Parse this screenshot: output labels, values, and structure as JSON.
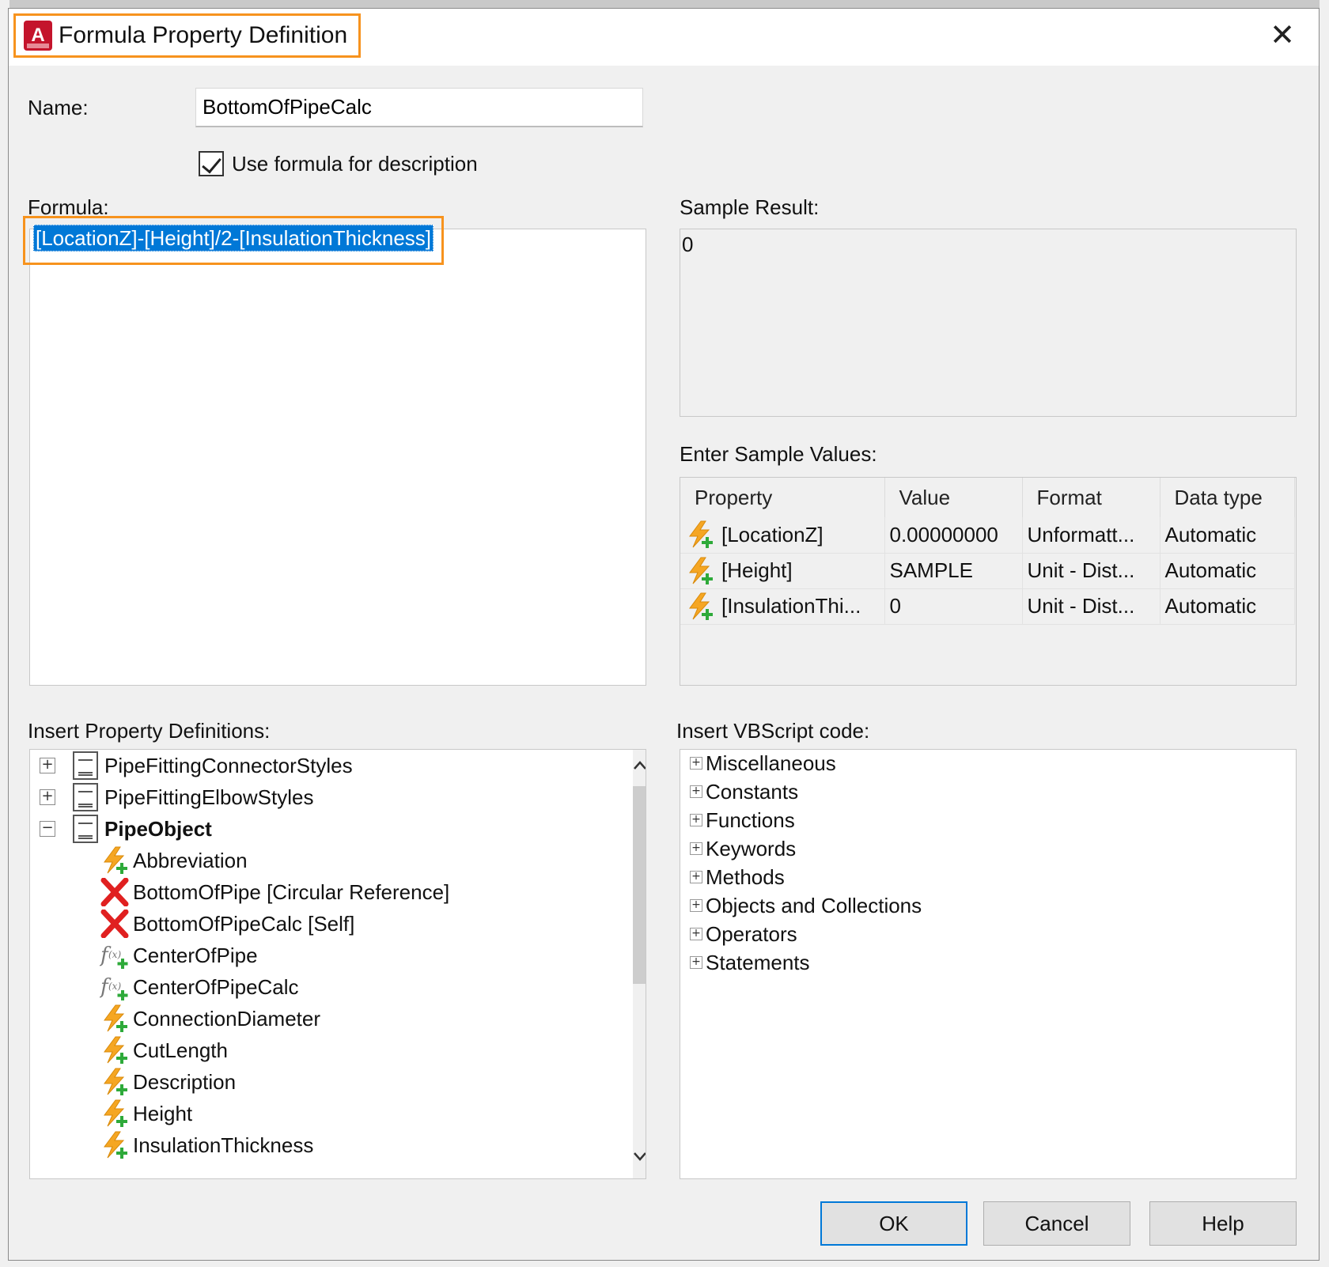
{
  "dialog": {
    "title": "Formula Property Definition",
    "app_icon_letter": "A",
    "close_glyph": "✕"
  },
  "name": {
    "label": "Name:",
    "value": "BottomOfPipeCalc"
  },
  "use_formula_for_description": {
    "label": "Use formula for description",
    "checked": true
  },
  "formula": {
    "label": "Formula:",
    "value": "[LocationZ]-[Height]/2-[InsulationThickness]"
  },
  "sample_result": {
    "label": "Sample Result:",
    "value": "0"
  },
  "sample_values": {
    "label": "Enter Sample Values:",
    "columns": [
      "Property",
      "Value",
      "Format",
      "Data type"
    ],
    "rows": [
      {
        "property": "[LocationZ]",
        "value": "0.00000000",
        "format": "Unformatt...",
        "data_type": "Automatic"
      },
      {
        "property": "[Height]",
        "value": "SAMPLE",
        "format": "Unit - Dist...",
        "data_type": "Automatic"
      },
      {
        "property": "[InsulationThi...",
        "value": "0",
        "format": "Unit - Dist...",
        "data_type": "Automatic"
      }
    ]
  },
  "insert_property_definitions": {
    "label": "Insert Property Definitions:",
    "groups": [
      {
        "name": "PipeFittingConnectorStyles",
        "expander": "+"
      },
      {
        "name": "PipeFittingElbowStyles",
        "expander": "+"
      },
      {
        "name": "PipeObject",
        "expander": "−"
      }
    ],
    "items": [
      {
        "name": "Abbreviation",
        "icon": "lightning-plus-icon"
      },
      {
        "name": "BottomOfPipe [Circular Reference]",
        "icon": "red-x-icon"
      },
      {
        "name": "BottomOfPipeCalc [Self]",
        "icon": "red-x-icon"
      },
      {
        "name": "CenterOfPipe",
        "icon": "formula-fx-icon"
      },
      {
        "name": "CenterOfPipeCalc",
        "icon": "formula-fx-icon"
      },
      {
        "name": "ConnectionDiameter",
        "icon": "lightning-plus-icon"
      },
      {
        "name": "CutLength",
        "icon": "lightning-plus-icon"
      },
      {
        "name": "Description",
        "icon": "lightning-plus-icon"
      },
      {
        "name": "Height",
        "icon": "lightning-plus-icon"
      },
      {
        "name": "InsulationThickness",
        "icon": "lightning-plus-icon"
      }
    ]
  },
  "insert_vbscript": {
    "label": "Insert VBScript code:",
    "items": [
      "Miscellaneous",
      "Constants",
      "Functions",
      "Keywords",
      "Methods",
      "Objects and Collections",
      "Operators",
      "Statements"
    ]
  },
  "buttons": {
    "ok": "OK",
    "cancel": "Cancel",
    "help": "Help"
  },
  "colors": {
    "highlight_outline": "#f7931e",
    "selection": "#0078d7",
    "app_icon": "#c4142c",
    "lightning": "#f5a623",
    "plus": "#2eaa3a",
    "error_x": "#e02020"
  }
}
